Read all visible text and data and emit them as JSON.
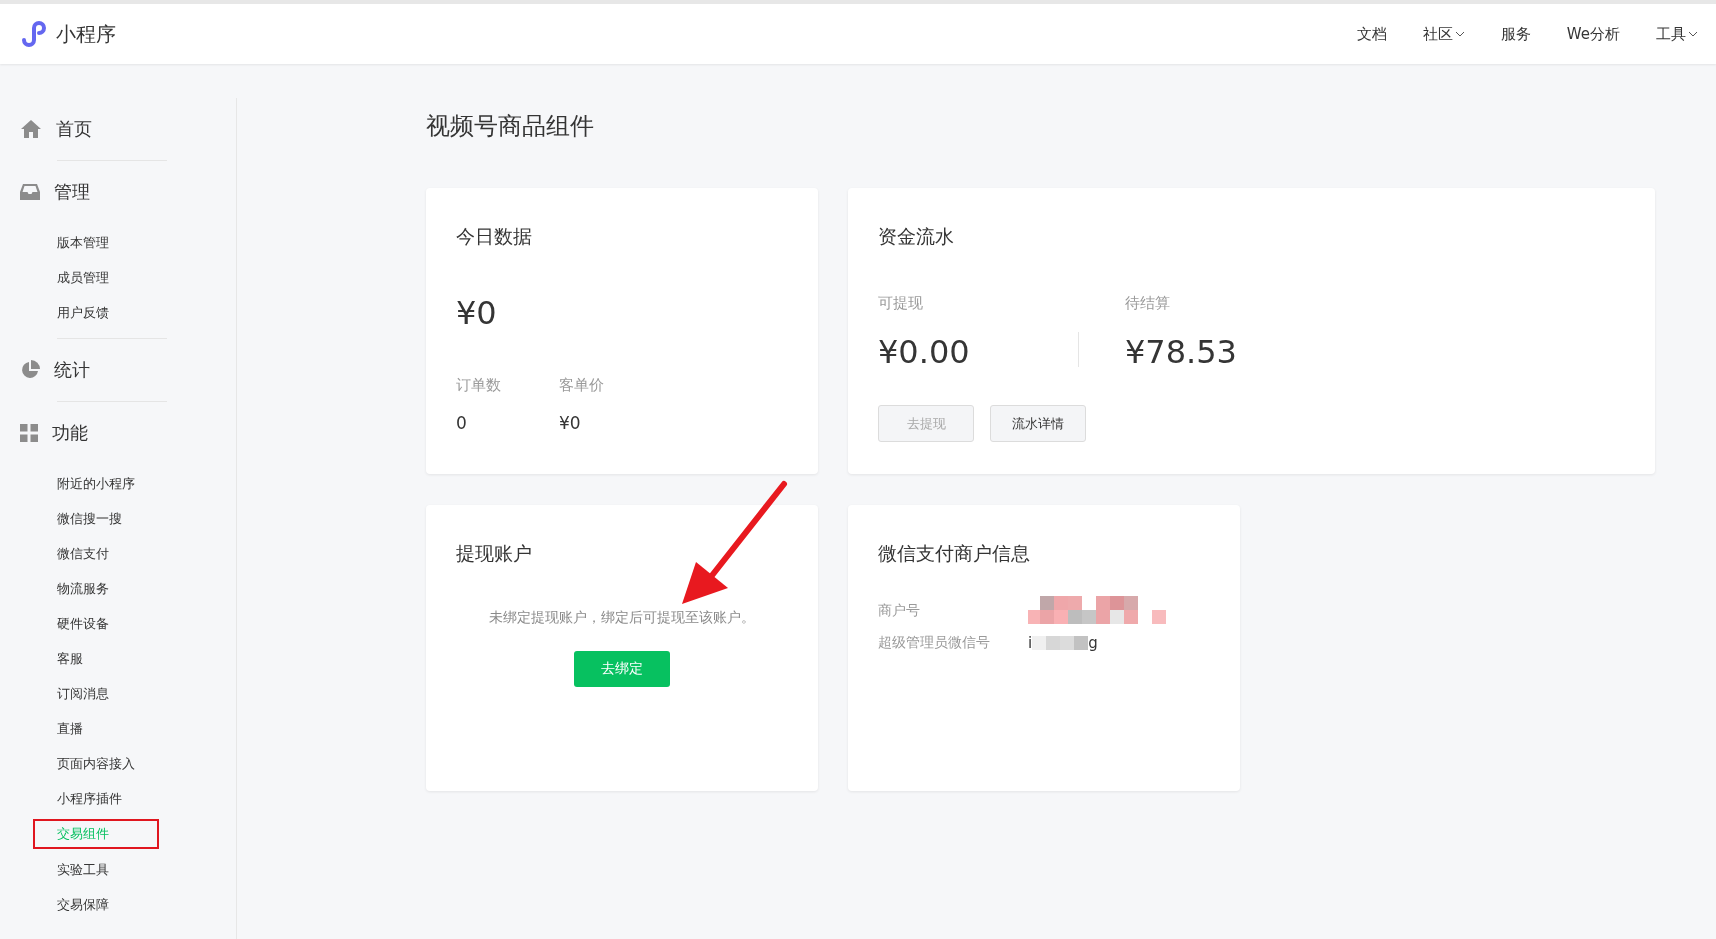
{
  "header": {
    "logo_text": "小程序",
    "nav": [
      {
        "label": "文档",
        "dropdown": false
      },
      {
        "label": "社区",
        "dropdown": true
      },
      {
        "label": "服务",
        "dropdown": false
      },
      {
        "label": "We分析",
        "dropdown": false
      },
      {
        "label": "工具",
        "dropdown": true
      }
    ]
  },
  "sidebar": {
    "sections": [
      {
        "label": "首页"
      },
      {
        "label": "管理",
        "items": [
          {
            "label": "版本管理",
            "selected": false,
            "annotated": false
          },
          {
            "label": "成员管理",
            "selected": false,
            "annotated": false
          },
          {
            "label": "用户反馈",
            "selected": false,
            "annotated": false
          }
        ]
      },
      {
        "label": "统计"
      },
      {
        "label": "功能",
        "items": [
          {
            "label": "附近的小程序",
            "selected": false,
            "annotated": false
          },
          {
            "label": "微信搜一搜",
            "selected": false,
            "annotated": false
          },
          {
            "label": "微信支付",
            "selected": false,
            "annotated": false
          },
          {
            "label": "物流服务",
            "selected": false,
            "annotated": false
          },
          {
            "label": "硬件设备",
            "selected": false,
            "annotated": false
          },
          {
            "label": "客服",
            "selected": false,
            "annotated": false
          },
          {
            "label": "订阅消息",
            "selected": false,
            "annotated": false
          },
          {
            "label": "直播",
            "selected": false,
            "annotated": false
          },
          {
            "label": "页面内容接入",
            "selected": false,
            "annotated": false
          },
          {
            "label": "小程序插件",
            "selected": false,
            "annotated": false
          },
          {
            "label": "交易组件",
            "selected": true,
            "annotated": true
          },
          {
            "label": "实验工具",
            "selected": false,
            "annotated": false
          },
          {
            "label": "交易保障",
            "selected": false,
            "annotated": false
          }
        ]
      }
    ]
  },
  "page_title": "视频号商品组件",
  "today": {
    "title": "今日数据",
    "amount": "¥0",
    "stats": [
      {
        "label": "订单数",
        "value": "0"
      },
      {
        "label": "客单价",
        "value": "¥0"
      }
    ]
  },
  "funds": {
    "title": "资金流水",
    "columns": [
      {
        "label": "可提现",
        "value": "¥0.00"
      },
      {
        "label": "待结算",
        "value": "¥78.53"
      }
    ],
    "buttons": [
      {
        "label": "去提现",
        "disabled": true
      },
      {
        "label": "流水详情",
        "disabled": false
      }
    ]
  },
  "withdraw_account": {
    "title": "提现账户",
    "message": "未绑定提现账户，绑定后可提现至该账户。",
    "button": "去绑定",
    "annotation_arrow": true
  },
  "merchant": {
    "title": "微信支付商户信息",
    "rows": [
      {
        "label": "商户号",
        "redacted": true
      },
      {
        "label": "超级管理员微信号",
        "value_start": "i",
        "value_end": "g",
        "redacted": true
      }
    ]
  }
}
